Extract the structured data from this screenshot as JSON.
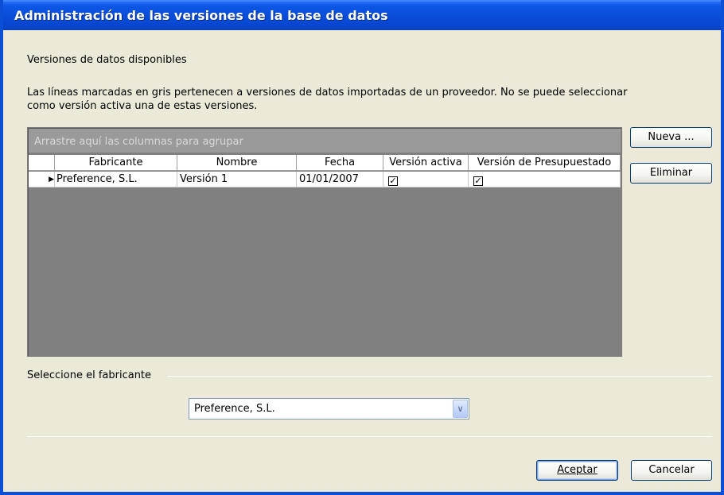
{
  "window": {
    "title": "Administración de las versiones de la base de datos"
  },
  "versions_label": "Versiones de datos disponibles",
  "description": "Las líneas marcadas en gris pertenecen a versiones de datos importadas de un proveedor. No se puede seleccionar como versión activa una de estas versiones.",
  "grid": {
    "group_hint": "Arrastre aquí las columnas para agrupar",
    "columns": [
      "Fabricante",
      "Nombre",
      "Fecha",
      "Versión activa",
      "Versión de Presupuestado"
    ],
    "rows": [
      {
        "fabricante": "Preference, S.L.",
        "nombre": "Versión 1",
        "fecha": "01/01/2007",
        "version_activa": true,
        "version_presupuestado": true
      }
    ]
  },
  "buttons": {
    "nueva": "Nueva ...",
    "eliminar": "Eliminar",
    "aceptar": "Aceptar",
    "cancelar": "Cancelar"
  },
  "fabricante_section": {
    "label": "Seleccione el fabricante",
    "selected": "Preference, S.L."
  },
  "icons": {
    "row_indicator": "triangle-right-icon",
    "dropdown": "chevron-down-icon",
    "checkbox_checked": "checkmark-icon"
  },
  "colors": {
    "titlebar": "#0a4dd9",
    "window_bg": "#ece9d8",
    "grid_bg": "#808080"
  }
}
